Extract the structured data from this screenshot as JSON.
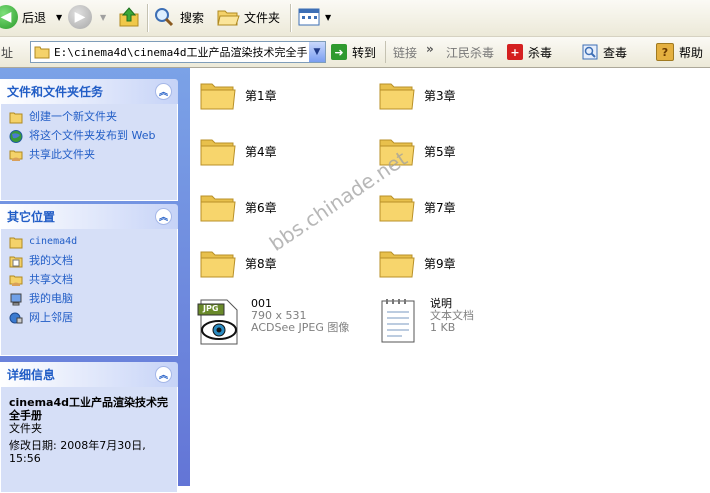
{
  "toolbar": {
    "back_label": "后退",
    "search_label": "搜索",
    "folders_label": "文件夹"
  },
  "addressbar": {
    "label": "址",
    "path": "E:\\cinema4d\\cinema4d工业产品渲染技术完全手",
    "go_label": "转到",
    "links_label": "链接",
    "link1": "江民杀毒",
    "link2": "杀毒",
    "link3": "查毒",
    "link4": "帮助"
  },
  "sidebar": {
    "tasks": {
      "title": "文件和文件夹任务",
      "items": [
        "创建一个新文件夹",
        "将这个文件夹发布到 Web",
        "共享此文件夹"
      ]
    },
    "places": {
      "title": "其它位置",
      "items": [
        "cinema4d",
        "我的文档",
        "共享文档",
        "我的电脑",
        "网上邻居"
      ]
    },
    "details": {
      "title": "详细信息",
      "name": "cinema4d工业产品渲染技术完全手册",
      "type": "文件夹",
      "modified": "修改日期: 2008年7月30日, 15:56"
    }
  },
  "files": {
    "folders": [
      "第1章",
      "第3章",
      "第4章",
      "第5章",
      "第6章",
      "第7章",
      "第8章",
      "第9章"
    ],
    "jpg": {
      "name": "001",
      "dims": "790 x 531",
      "type": "ACDSee JPEG 图像",
      "badge": "JPG"
    },
    "txt": {
      "name": "说明",
      "type": "文本文档",
      "size": "1 KB"
    }
  },
  "watermark": "bbs.chinade.net",
  "colors": {
    "folder": "#f7d56c",
    "sidebar_top": "#7ba2e7",
    "sidebar_bottom": "#6375d6",
    "link": "#215dc6"
  }
}
